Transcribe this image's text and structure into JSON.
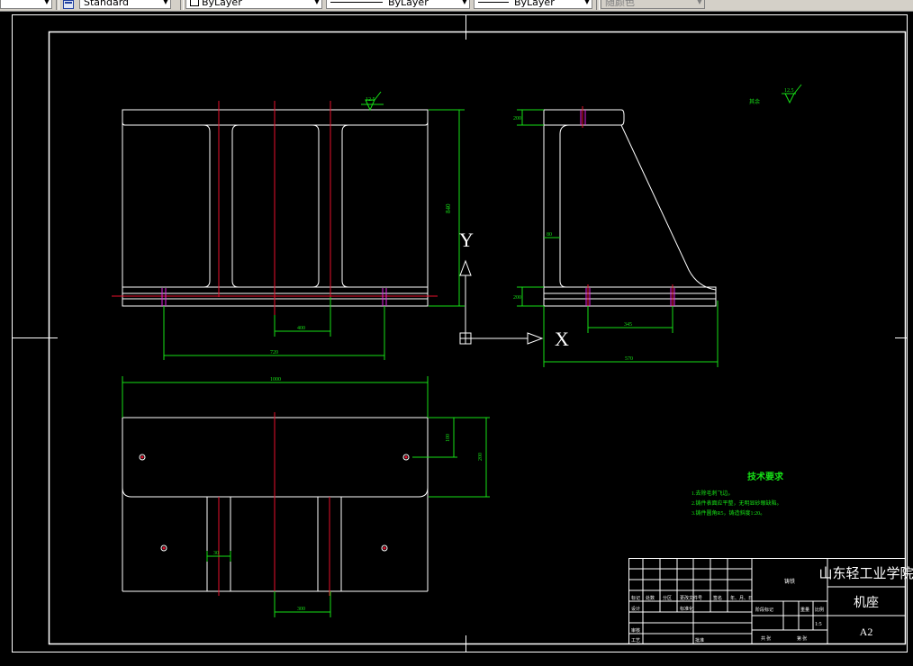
{
  "toolbar": {
    "textstyle": "Standard",
    "layer": "ByLayer",
    "linetype": "ByLayer",
    "lineweight": "ByLayer",
    "plotstyle": "随颜色"
  },
  "ucs": {
    "x_label": "X",
    "y_label": "Y"
  },
  "dimensions": {
    "front_h": "840",
    "front_inner": "400",
    "front_span": "720",
    "side_top": "200",
    "side_web": "80",
    "side_bottom": "200",
    "side_bolt": "345",
    "side_total": "570",
    "top_total": "1000",
    "top_hole": "100",
    "top_depth": "200",
    "top_slot_w": "30",
    "top_slot_span": "300"
  },
  "roughness": {
    "top": "12.5",
    "corner": "12.5",
    "corner_note": "其余"
  },
  "tech": {
    "title": "技术要求",
    "items": [
      "1.去除毛刺飞边。",
      "2.铸件表面应平整，无明显砂眼缺陷。",
      "3.铸件圆角R5，铸造斜度1:20。"
    ]
  },
  "title_block": {
    "school": "山东轻工业学院",
    "part": "机座",
    "sheet": "A2",
    "material": "铸铁",
    "scale": "1:5",
    "row_marks": "标记",
    "row_count": "处数",
    "row_zone": "分区",
    "row_docno": "更改文件号",
    "row_sign": "签名",
    "row_date": "年、月、日",
    "designer": "设计",
    "std": "标准化",
    "check": "审核",
    "process": "工艺",
    "approve": "批准",
    "stage": "阶段标记",
    "weight": "重量",
    "ratio": "比例",
    "total": "共  张",
    "page": "第  张"
  }
}
